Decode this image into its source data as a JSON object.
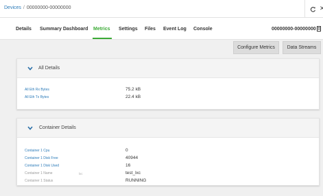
{
  "breadcrumb": {
    "root": "Devices",
    "separator": "/",
    "current": "00000000-00000000"
  },
  "tabs": [
    {
      "label": "Details"
    },
    {
      "label": "Summary Dashboard"
    },
    {
      "label": "Metrics",
      "active": true
    },
    {
      "label": "Settings"
    },
    {
      "label": "Files"
    },
    {
      "label": "Event Log"
    },
    {
      "label": "Console"
    }
  ],
  "device_id": "00000000-00000000",
  "actions": {
    "configure_metrics": "Configure Metrics",
    "data_streams": "Data Streams"
  },
  "sections": [
    {
      "title": "All Details",
      "rows": [
        {
          "label": "All Eth Rx Bytes",
          "value": "75.2 kB"
        },
        {
          "label": "All Eth Tx Bytes",
          "value": "22.4 kB"
        }
      ]
    },
    {
      "title": "Container Details",
      "rows": [
        {
          "label": "Container 1 Cpu",
          "value": "0"
        },
        {
          "label": "Container 1 Disk Free",
          "value": "40944"
        },
        {
          "label": "Container 1 Disk Used",
          "value": "16"
        },
        {
          "label": "Container 1 Name",
          "note": "lxc",
          "value": "test_lxc"
        },
        {
          "label": "Container 1 Status",
          "value": "RUNNING"
        }
      ]
    }
  ],
  "colors": {
    "link": "#2a7ab8",
    "active_tab": "#3aaa35",
    "background": "#f0f0f0"
  },
  "icons": [
    "refresh-icon",
    "close-icon",
    "document-icon",
    "chevron-down-icon"
  ]
}
